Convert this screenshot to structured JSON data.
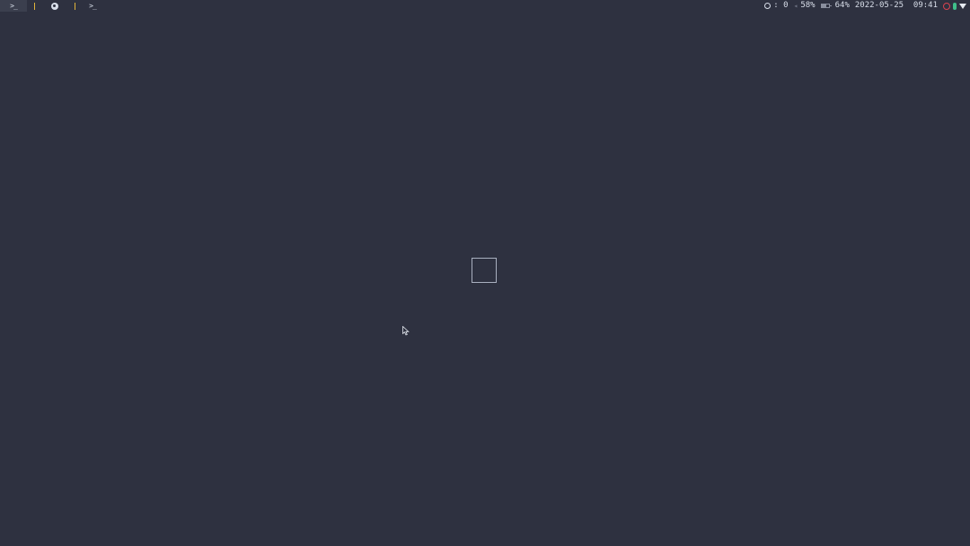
{
  "top_bar": {
    "workspaces": [
      {
        "label": ">_",
        "icon": "terminal-icon",
        "active": true
      },
      {
        "label": "",
        "icon": "firefox-icon",
        "active": false
      },
      {
        "label": ">_",
        "icon": "terminal-icon",
        "active": false
      }
    ],
    "github": {
      "icon": "github-icon",
      "text": ": 0"
    },
    "volume": {
      "icon": "volume-icon",
      "text": "58%"
    },
    "battery": {
      "icon": "battery-icon",
      "text": "64%"
    },
    "datetime": "2022-05-25  09:41",
    "tray": [
      "tray-red-icon",
      "tray-green-icon",
      "wifi-icon"
    ]
  },
  "colors": {
    "background": "#2e3140",
    "accent_separator": "#e0b43a",
    "text": "#d8dee9"
  }
}
